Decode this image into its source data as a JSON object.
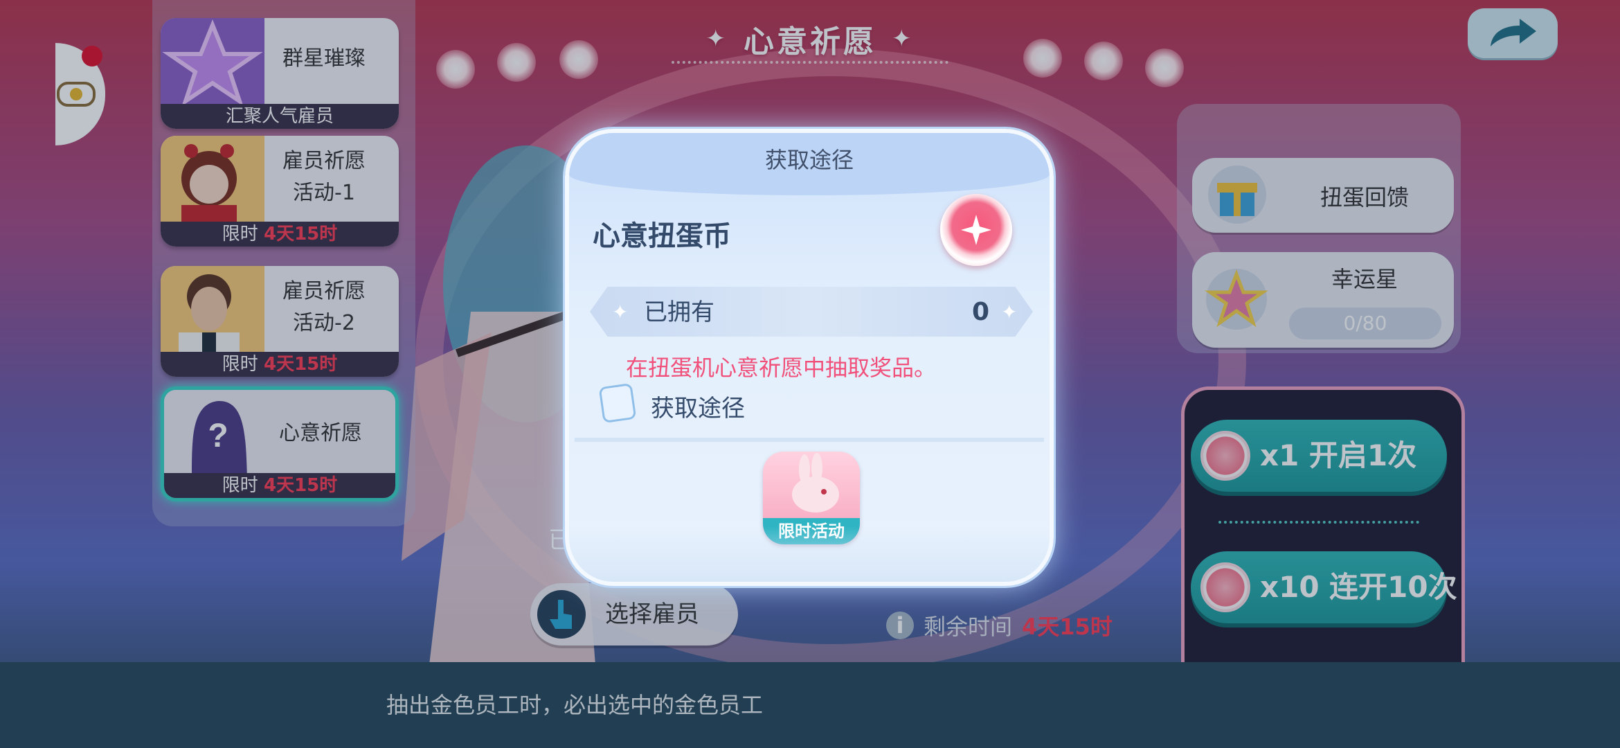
{
  "header": {
    "title": "心意祈愿"
  },
  "sidebar": {
    "items": [
      {
        "title": "群星璀璨",
        "footer": "汇聚人气雇员",
        "icon": "star-icon"
      },
      {
        "title_line1": "雇员祈愿",
        "title_line2": "活动-1",
        "limit_label": "限时",
        "remaining": "4天15时",
        "icon": "female-employee-portrait"
      },
      {
        "title_line1": "雇员祈愿",
        "title_line2": "活动-2",
        "limit_label": "限时",
        "remaining": "4天15时",
        "icon": "male-employee-portrait"
      },
      {
        "title": "心意祈愿",
        "limit_label": "限时",
        "remaining": "4天15时",
        "icon": "mystery-silhouette-icon",
        "active": true
      }
    ]
  },
  "right_panel": {
    "gacha_feedback": {
      "label": "扭蛋回馈",
      "icon": "gift-box-icon"
    },
    "lucky_star": {
      "label": "幸运星",
      "progress": "0/80",
      "icon": "lucky-star-icon"
    },
    "draw_once": {
      "label": "x1   开启1次"
    },
    "draw_ten": {
      "label": "x10 连开10次"
    }
  },
  "main": {
    "select_employee": "选择雇员",
    "remaining_label": "剩余时间",
    "remaining_value": "4天15时",
    "partial_text": "已"
  },
  "bottom": {
    "note": "抽出金色员工时，必出选中的金色员工"
  },
  "modal": {
    "title": "获取途径",
    "item_name": "心意扭蛋币",
    "owned_label": "已拥有",
    "owned_value": "0",
    "description": "在扭蛋机心意祈愿中抽取奖品。",
    "source_label": "获取途径",
    "activity_label": "限时活动"
  },
  "colors": {
    "accent_teal": "#2fb7b7",
    "limit_red": "#ff3c55",
    "desc_pink": "#f0507a",
    "modal_bg": "#e3effc"
  }
}
